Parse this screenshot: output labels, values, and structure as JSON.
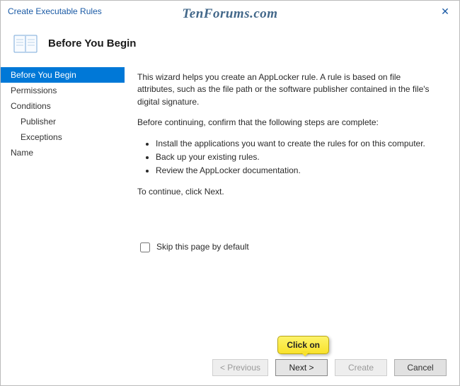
{
  "titlebar": {
    "title": "Create Executable Rules",
    "close_label": "✕"
  },
  "watermark": "TenForums.com",
  "header": {
    "title": "Before You Begin"
  },
  "sidebar": {
    "items": [
      {
        "label": "Before You Begin",
        "selected": true,
        "indent": false
      },
      {
        "label": "Permissions",
        "selected": false,
        "indent": false
      },
      {
        "label": "Conditions",
        "selected": false,
        "indent": false
      },
      {
        "label": "Publisher",
        "selected": false,
        "indent": true
      },
      {
        "label": "Exceptions",
        "selected": false,
        "indent": true
      },
      {
        "label": "Name",
        "selected": false,
        "indent": false
      }
    ]
  },
  "content": {
    "intro": "This wizard helps you create an AppLocker rule. A rule is based on file attributes, such as the file path or the software publisher contained in the file's digital signature.",
    "before": "Before continuing, confirm that the following steps are complete:",
    "bullets": [
      "Install the applications you want to create the rules for on this computer.",
      "Back up your existing rules.",
      "Review the AppLocker documentation."
    ],
    "continue": "To continue, click Next.",
    "skip_label": "Skip this page by default"
  },
  "footer": {
    "previous": "< Previous",
    "next": "Next >",
    "create": "Create",
    "cancel": "Cancel"
  },
  "tooltip": "Click on"
}
